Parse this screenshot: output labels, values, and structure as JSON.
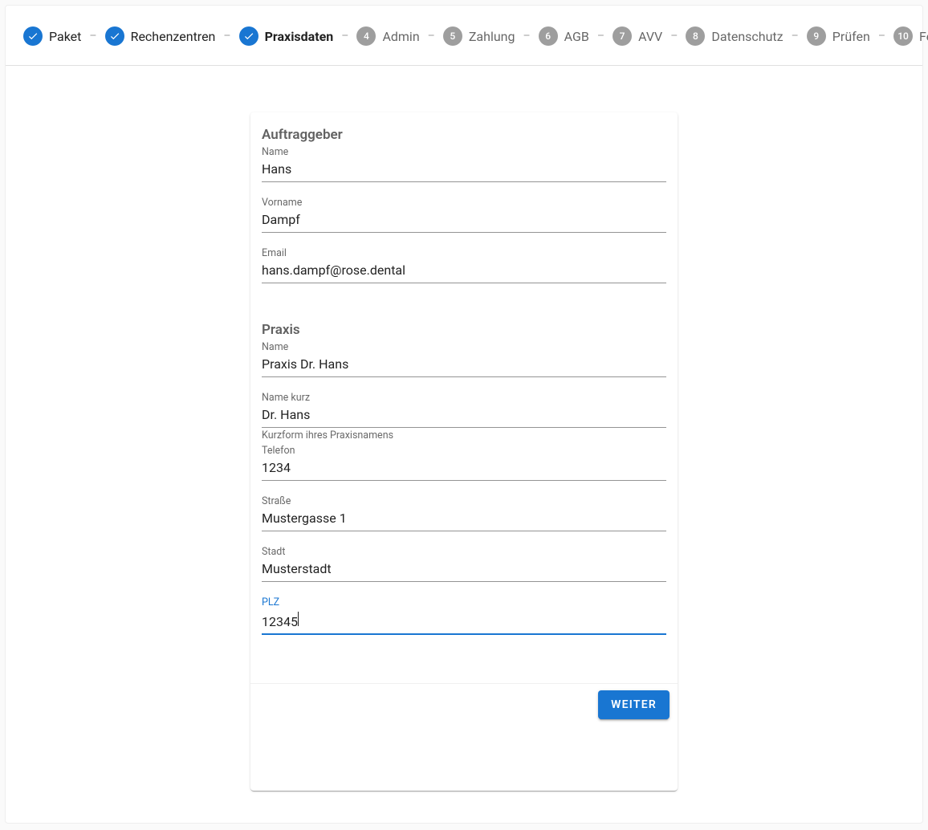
{
  "stepper": {
    "steps": [
      {
        "label": "Paket",
        "state": "completed"
      },
      {
        "label": "Rechenzentren",
        "state": "completed"
      },
      {
        "label": "Praxisdaten",
        "state": "active"
      },
      {
        "num": "4",
        "label": "Admin",
        "state": "inactive"
      },
      {
        "num": "5",
        "label": "Zahlung",
        "state": "inactive"
      },
      {
        "num": "6",
        "label": "AGB",
        "state": "inactive"
      },
      {
        "num": "7",
        "label": "AVV",
        "state": "inactive"
      },
      {
        "num": "8",
        "label": "Datenschutz",
        "state": "inactive"
      },
      {
        "num": "9",
        "label": "Prüfen",
        "state": "inactive"
      },
      {
        "num": "10",
        "label": "Fertig",
        "state": "inactive"
      }
    ]
  },
  "form": {
    "section_auftraggeber": {
      "title": "Auftraggeber",
      "name": {
        "label": "Name",
        "value": "Hans"
      },
      "vorname": {
        "label": "Vorname",
        "value": "Dampf"
      },
      "email": {
        "label": "Email",
        "value": "hans.dampf@rose.dental"
      }
    },
    "section_praxis": {
      "title": "Praxis",
      "name": {
        "label": "Name",
        "value": "Praxis Dr. Hans"
      },
      "name_kurz": {
        "label": "Name kurz",
        "value": "Dr. Hans",
        "hint": "Kurzform ihres Praxisnamens"
      },
      "telefon": {
        "label": "Telefon",
        "value": "1234"
      },
      "strasse": {
        "label": "Straße",
        "value": "Mustergasse 1"
      },
      "stadt": {
        "label": "Stadt",
        "value": "Musterstadt"
      },
      "plz": {
        "label": "PLZ",
        "value": "12345"
      }
    }
  },
  "actions": {
    "next": "Weiter"
  }
}
